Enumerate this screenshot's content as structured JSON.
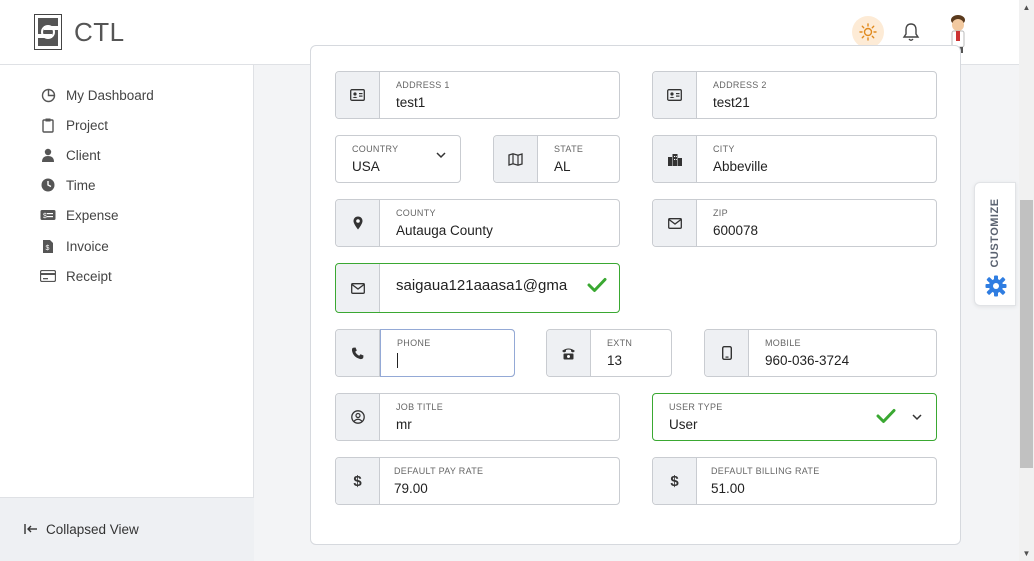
{
  "header": {
    "brand": "CTL",
    "colors": {
      "accent": "#2f7de1",
      "success": "#3aa832",
      "sun_bg": "#fdebd6"
    }
  },
  "sidebar": {
    "items": [
      {
        "label": "My Dashboard",
        "icon": "dashboard-icon"
      },
      {
        "label": "Project",
        "icon": "clipboard-icon"
      },
      {
        "label": "Client",
        "icon": "user-icon"
      },
      {
        "label": "Time",
        "icon": "clock-icon"
      },
      {
        "label": "Expense",
        "icon": "money-icon"
      },
      {
        "label": "Invoice",
        "icon": "invoice-icon"
      },
      {
        "label": "Receipt",
        "icon": "receipt-icon"
      }
    ],
    "collapse_label": "Collapsed View"
  },
  "form": {
    "address1": {
      "label": "ADDRESS 1",
      "value": "test1"
    },
    "address2": {
      "label": "ADDRESS 2",
      "value": "test21"
    },
    "country": {
      "label": "COUNTRY",
      "value": "USA"
    },
    "state": {
      "label": "STATE",
      "value": "AL"
    },
    "city": {
      "label": "CITY",
      "value": "Abbeville"
    },
    "county": {
      "label": "COUNTY",
      "value": "Autauga County"
    },
    "zip": {
      "label": "ZIP",
      "value": "600078"
    },
    "email": {
      "value": "saigaua121aaasa1@gma"
    },
    "phone": {
      "label": "PHONE",
      "value": ""
    },
    "extn": {
      "label": "EXTN",
      "value": "13"
    },
    "mobile": {
      "label": "MOBILE",
      "value": "960-036-3724"
    },
    "job_title": {
      "label": "JOB TITLE",
      "value": "mr"
    },
    "user_type": {
      "label": "USER TYPE",
      "value": "User"
    },
    "pay_rate": {
      "label": "DEFAULT PAY RATE",
      "value": "79.00"
    },
    "billing_rate": {
      "label": "DEFAULT BILLING RATE",
      "value": "51.00"
    }
  },
  "customize": {
    "label": "CUSTOMIZE"
  }
}
